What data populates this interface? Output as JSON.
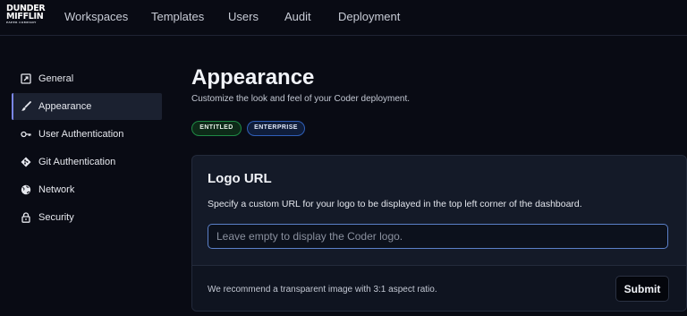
{
  "brand": {
    "line1": "DUNDER",
    "line2": "MIFFLIN",
    "line3": "PAPER COMPANY"
  },
  "nav": {
    "items": [
      {
        "label": "Workspaces"
      },
      {
        "label": "Templates"
      },
      {
        "label": "Users"
      },
      {
        "label": "Audit"
      },
      {
        "label": "Deployment"
      }
    ]
  },
  "sidebar": {
    "items": [
      {
        "label": "General",
        "icon": "launch-icon",
        "active": false
      },
      {
        "label": "Appearance",
        "icon": "brush-icon",
        "active": true
      },
      {
        "label": "User Authentication",
        "icon": "key-icon",
        "active": false
      },
      {
        "label": "Git Authentication",
        "icon": "git-icon",
        "active": false
      },
      {
        "label": "Network",
        "icon": "globe-icon",
        "active": false
      },
      {
        "label": "Security",
        "icon": "lock-icon",
        "active": false
      }
    ]
  },
  "page": {
    "title": "Appearance",
    "subtitle": "Customize the look and feel of your Coder deployment.",
    "badges": {
      "entitled": "ENTITLED",
      "enterprise": "ENTERPRISE"
    }
  },
  "logo_card": {
    "title": "Logo URL",
    "description": "Specify a custom URL for your logo to be displayed in the top left corner of the dashboard.",
    "input_value": "",
    "input_placeholder": "Leave empty to display the Coder logo.",
    "footer_note": "We recommend a transparent image with 3:1 aspect ratio.",
    "submit_label": "Submit"
  },
  "colors": {
    "background": "#090b14",
    "card": "#141a28",
    "accent": "#7a86e8",
    "input_border": "#5b80c8",
    "entitled_border": "#1f8a45",
    "enterprise_border": "#2f5fb8"
  }
}
